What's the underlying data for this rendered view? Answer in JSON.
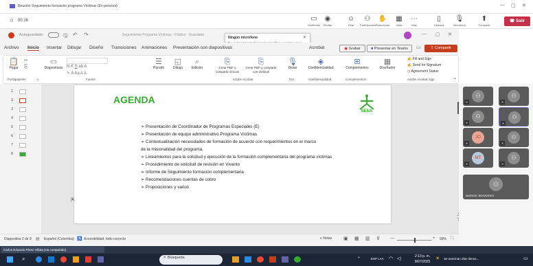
{
  "teams": {
    "window_title": "Reunión Seguimiento formación programa Víctimas (En persona)",
    "timer": "00:16",
    "toolbar": [
      {
        "label": "Contenido",
        "glyph": "▭"
      },
      {
        "label": "Ocultar",
        "glyph": "◉"
      },
      {
        "label": "Chat",
        "glyph": "☺"
      },
      {
        "label": "Participantes",
        "glyph": "⚇"
      },
      {
        "label": "Reaccionar",
        "glyph": "✋"
      },
      {
        "label": "Vista",
        "glyph": "▦"
      },
      {
        "label": "Más",
        "glyph": "⋯"
      },
      {
        "label": "Cámara",
        "glyph": "▯"
      },
      {
        "label": "Micrófono",
        "glyph": "🎙"
      },
      {
        "label": "Compartir",
        "glyph": "⬆"
      }
    ],
    "leave_label": "Salir"
  },
  "ppt": {
    "autosave_label": "Autoguardado",
    "autosave_state": "Desactivado",
    "doc_title": "Seguimiento Programa Víctimas · Público · Guardado",
    "tabs": [
      "Archivo",
      "Inicio",
      "Insertar",
      "Dibujar",
      "Diseño",
      "Transiciones",
      "Animaciones",
      "Presentación con diapositivas",
      "Acrobat"
    ],
    "right_buttons": {
      "record": "Grabar",
      "present": "Presentar en Teams",
      "share": "Compartir"
    },
    "ribbon": {
      "groups": [
        "Portapapeles",
        "Fuente",
        "Adobe Acrobat",
        "Voz",
        "Confidencialidad",
        "Complementos",
        "Adobe Acrobat Sign"
      ],
      "buttons": [
        "Pegar",
        "Diapositivas",
        "Párrafo",
        "Dibujo",
        "Edición",
        "Crear PDF y compartir vínculo",
        "Crear PDF y compartir con Outlook",
        "Dictar",
        "Confidencialidad",
        "Complementos",
        "Diseñador"
      ],
      "sign_items": [
        "Fill and Sign",
        "Send for Signature",
        "Agreement Status"
      ]
    },
    "toast": {
      "title": "Ningún micrófono",
      "body": "No se ha encontrado ningún micrófono conecte uno o disfrute escuchando."
    },
    "slide_numbers": [
      "1",
      "2",
      "3",
      "4",
      "5",
      "6",
      "7",
      "8"
    ],
    "status": {
      "slide_info": "Diapositiva 2 de 9",
      "language": "Español (Colombia)",
      "accessibility": "Accesibilidad: todo correcto",
      "notes": "Notas",
      "zoom": "99%"
    }
  },
  "slide": {
    "title": "AGENDA",
    "logo_text": "SENA",
    "items": [
      "Presentación de Coordinador de Programas Especiales (E)",
      "Presentación de equipo administrativo Programa Víctimas",
      "Contextualización necesidades de formación de acuerdo con requerimientos en el marco",
      "de la misionalidad del programa.",
      "Lineamientos para la solicitud y ejecución de la formación complementaria del programa víctimas",
      "Procedimiento de solicitud de revisión en Vivanto",
      "Informe de Seguimiento formación complementaria",
      "Recomendaciones cuentas de cobro",
      "Proposiciones y varios"
    ],
    "bulleted": [
      true,
      true,
      true,
      false,
      true,
      true,
      true,
      true,
      true
    ]
  },
  "participants": {
    "initials": [
      "",
      "",
      "",
      "",
      "JO",
      "",
      "MT",
      "",
      ""
    ],
    "name_bar": "MARICEL BENAVIDES"
  },
  "taskbar": {
    "search_placeholder": "Búsqueda",
    "time": "2:13 p. m.",
    "date": "8/07/2025",
    "lang": "ESP LAA",
    "notification": "Se avecinan días llenos...",
    "window_label": "Carlos Eduardo Pérez Villota (Ha compartido)"
  },
  "colors": {
    "sena_green": "#39a935",
    "teams_red": "#c4314b",
    "share_orange": "#c43e1c"
  }
}
